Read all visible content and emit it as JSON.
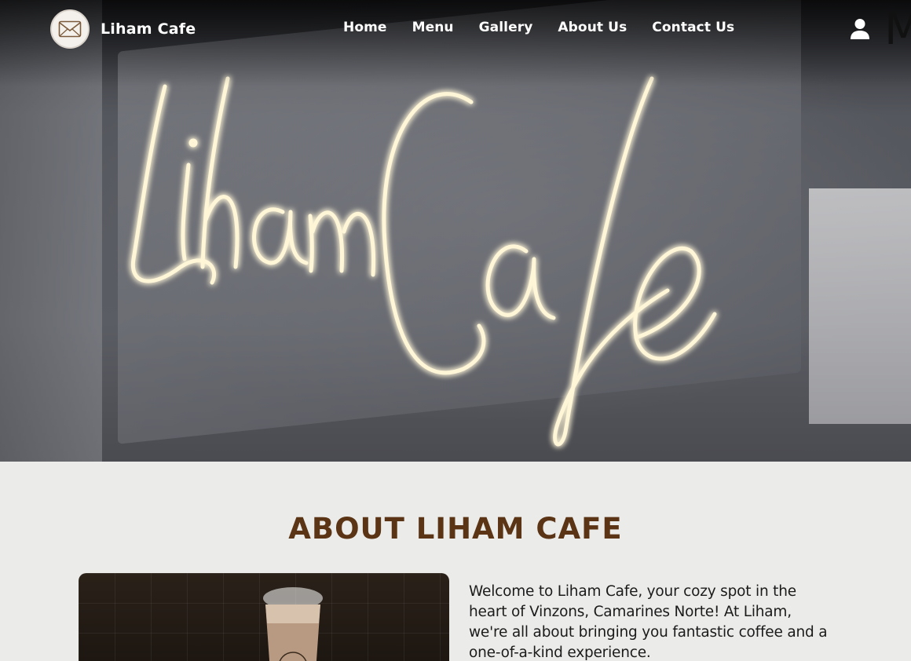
{
  "brand": {
    "name": "Liham Cafe",
    "logo_icon": "envelope-logo-icon"
  },
  "nav": {
    "items": [
      {
        "label": "Home"
      },
      {
        "label": "Menu"
      },
      {
        "label": "Gallery"
      },
      {
        "label": "About Us"
      },
      {
        "label": "Contact Us"
      }
    ],
    "user_icon": "user-icon",
    "partial_text": "M"
  },
  "hero": {
    "sign_text": "Liham Cafe"
  },
  "about": {
    "title": "ABOUT LIHAM CAFE",
    "body": "Welcome to Liham Cafe, your cozy spot in the heart of Vinzons, Camarines Norte! At Liham, we're all about bringing you fantastic coffee and a one-of-a-kind experience."
  },
  "colors": {
    "title_brown": "#5a3414",
    "background": "#ebebe9",
    "nav_text": "#ffffff"
  }
}
